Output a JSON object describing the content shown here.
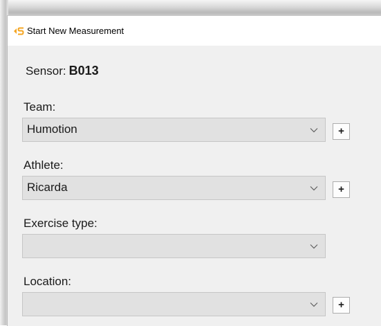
{
  "window": {
    "title": "Start New Measurement",
    "icon": "app-logo-icon",
    "accent": "#f5a623"
  },
  "sensor": {
    "label": "Sensor:",
    "value": "B013"
  },
  "team": {
    "label": "Team:",
    "selected": "Humotion",
    "add_label": "+"
  },
  "athlete": {
    "label": "Athlete:",
    "selected": "Ricarda",
    "add_label": "+"
  },
  "exercise_type": {
    "label": "Exercise type:",
    "selected": ""
  },
  "location": {
    "label": "Location:",
    "selected": "",
    "add_label": "+"
  }
}
